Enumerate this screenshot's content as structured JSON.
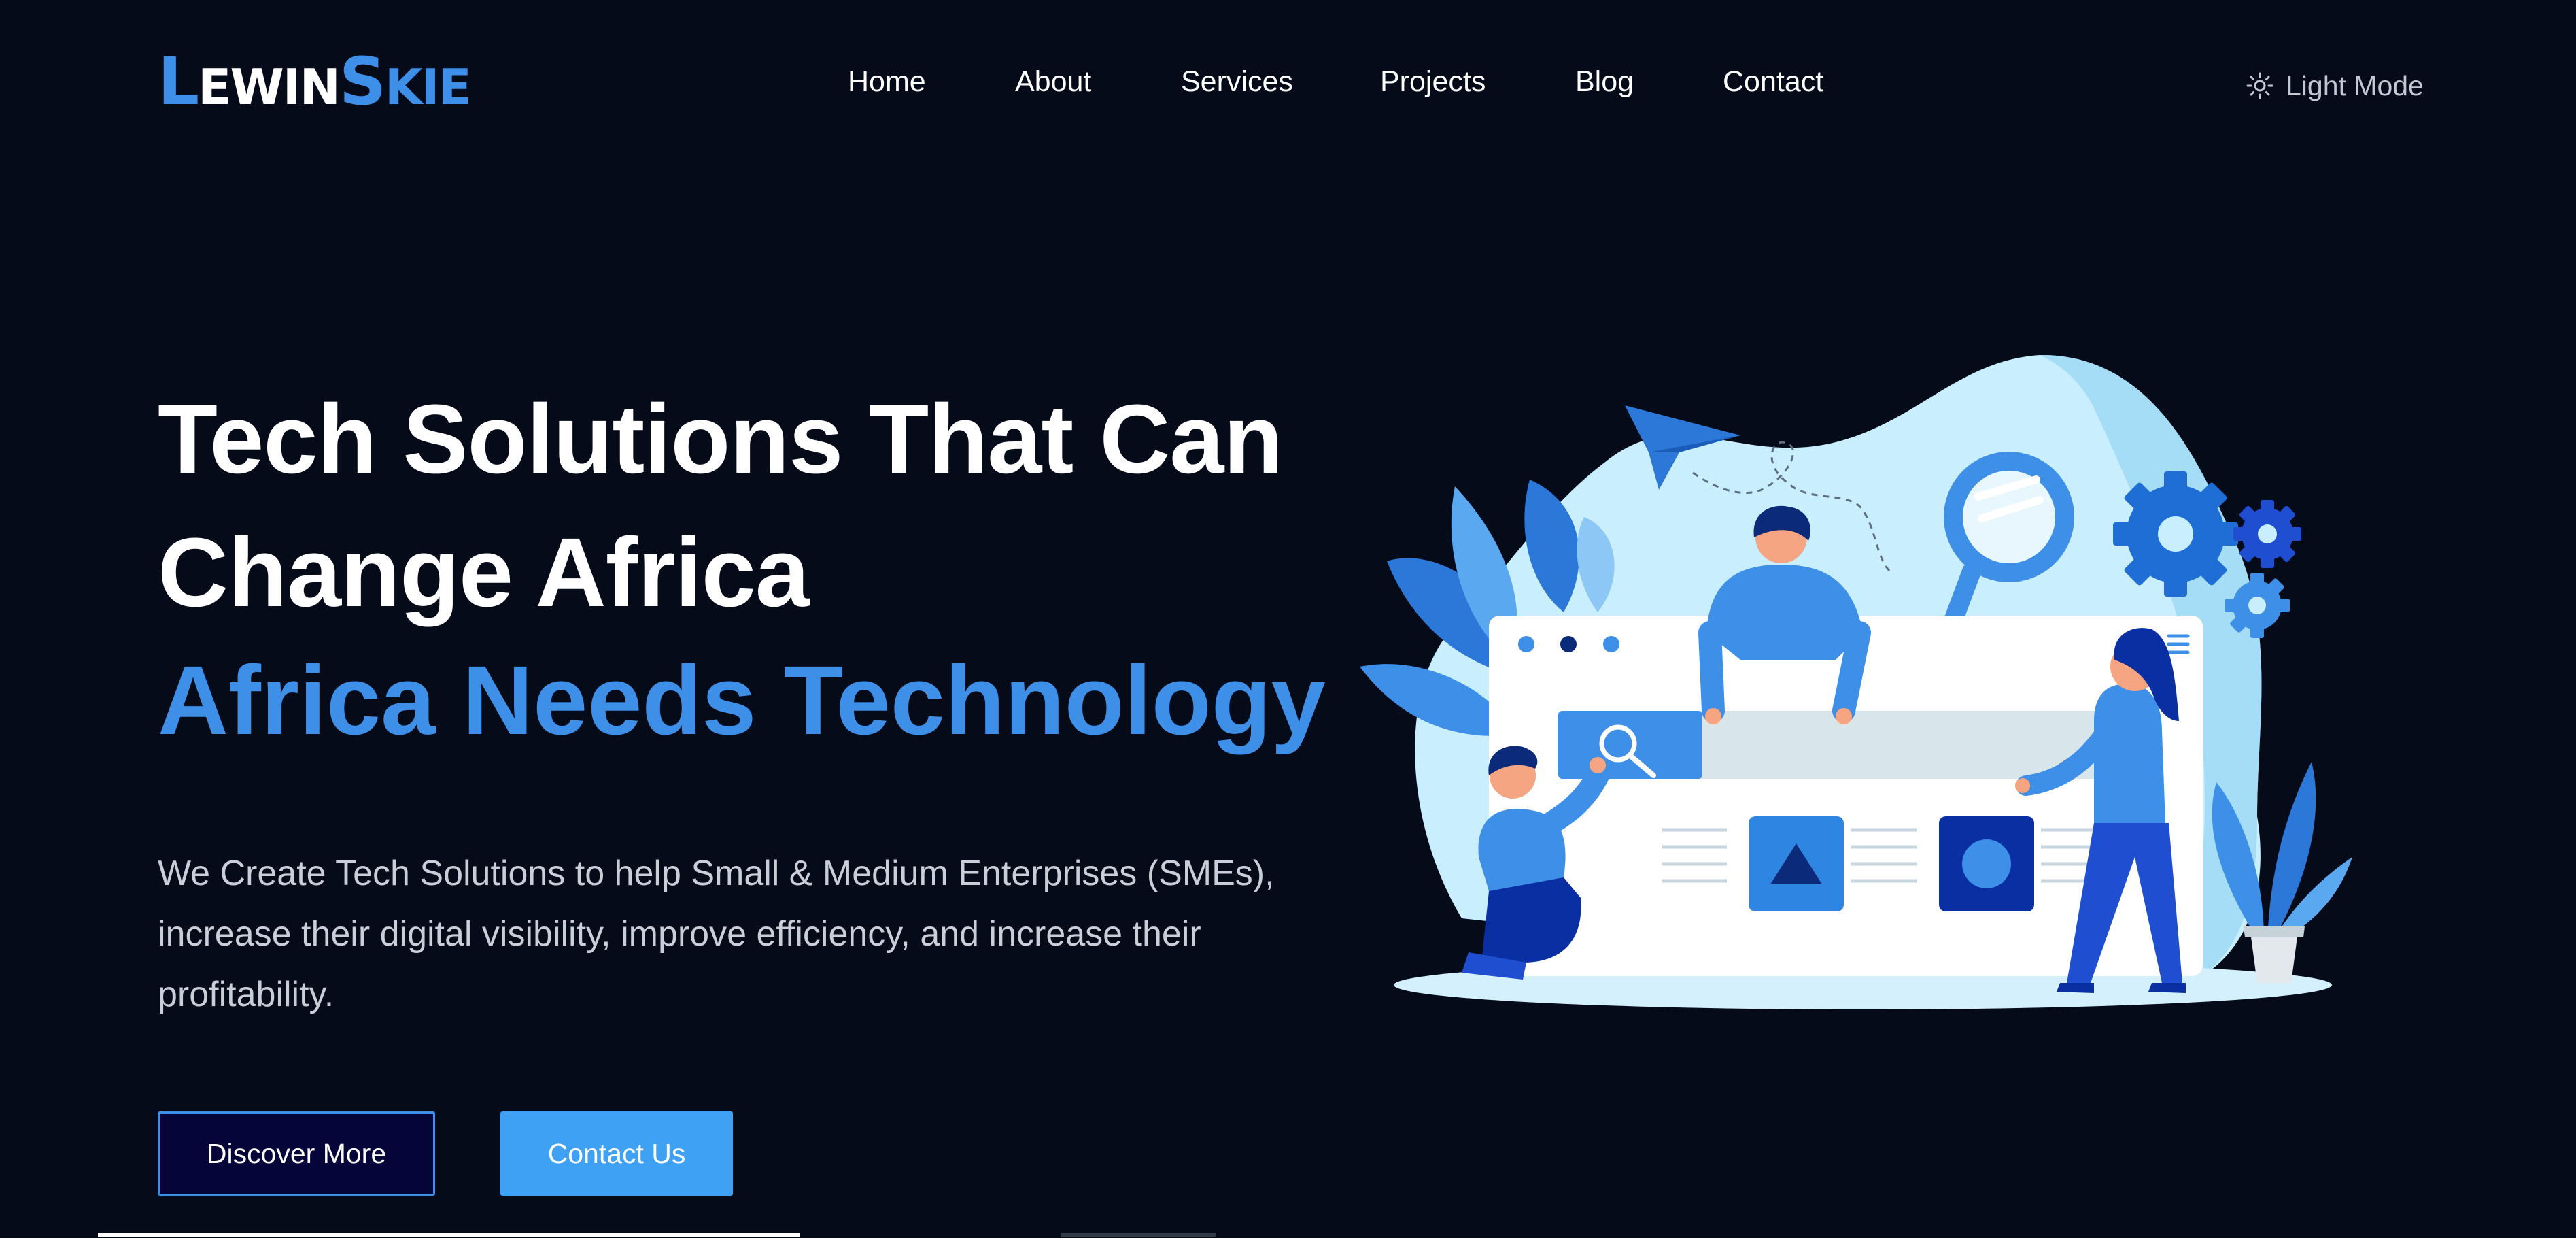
{
  "logo": {
    "l": "L",
    "ewin": "EWIN",
    "s": "S",
    "kie": "KIE"
  },
  "nav": {
    "items": [
      "Home",
      "About",
      "Services",
      "Projects",
      "Blog",
      "Contact"
    ]
  },
  "mode_toggle": {
    "label": "Light Mode",
    "icon": "sun-icon"
  },
  "hero": {
    "title_line1": "Tech Solutions That Can",
    "title_line2": "Change Africa",
    "subtitle": "Africa Needs Technology",
    "description": "We Create Tech Solutions to help Small & Medium Enterprises (SMEs), increase their digital visibility, improve efficiency, and increase their profitability."
  },
  "buttons": {
    "discover": "Discover More",
    "contact": "Contact Us"
  },
  "colors": {
    "background": "#060b1a",
    "accent": "#3d8fe8",
    "contact_button": "#3fa1f3",
    "discover_button": "#06053a",
    "text": "#ffffff",
    "muted_text": "#c9ced8"
  }
}
